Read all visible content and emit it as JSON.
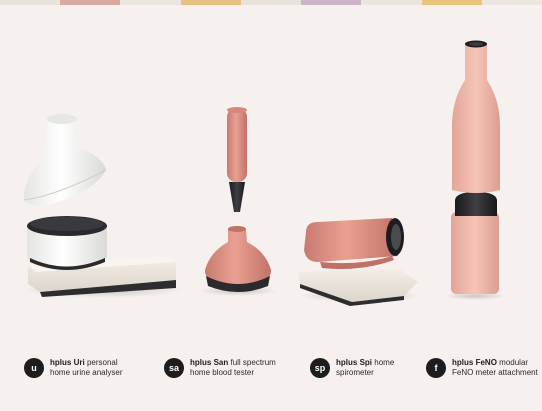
{
  "colors": {
    "background": "#f6f1ee",
    "salmon": "#e0958a",
    "pink": "#efb8ab",
    "ceramic_white": "#f4f4f2",
    "base_stone": "#eee8e0",
    "dark": "#2b2b2e"
  },
  "products": [
    {
      "badge": "u",
      "brand": "hplus",
      "name": "Uri",
      "desc_line1": "personal",
      "desc_line2": "home urine analyser"
    },
    {
      "badge": "sa",
      "brand": "hplus",
      "name": "San",
      "desc_line1": "full spectrum",
      "desc_line2": "home blood tester"
    },
    {
      "badge": "sp",
      "brand": "hplus",
      "name": "Spi",
      "desc_line1": "home",
      "desc_line2": "spirometer"
    },
    {
      "badge": "f",
      "brand": "hplus",
      "name": "FeNO",
      "desc_line1": "modular",
      "desc_line2": "FeNO meter attachment"
    }
  ]
}
